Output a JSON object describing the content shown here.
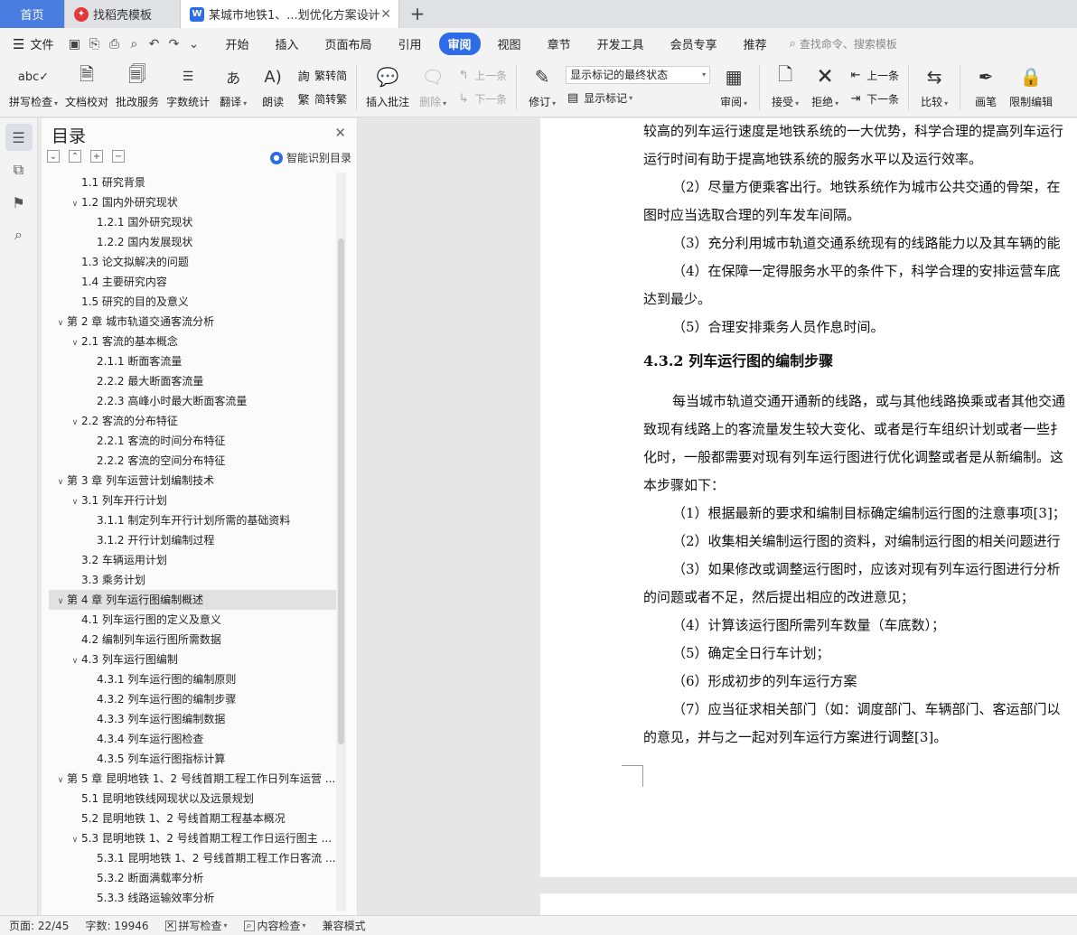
{
  "tabs": [
    {
      "label": "首页"
    },
    {
      "label": "找稻壳模板"
    },
    {
      "label": "某城市地铁1、...划优化方案设计"
    }
  ],
  "menubar": {
    "file": "文件",
    "items": [
      "开始",
      "插入",
      "页面布局",
      "引用",
      "审阅",
      "视图",
      "章节",
      "开发工具",
      "会员专享",
      "推荐"
    ],
    "active": "审阅",
    "search_placeholder": "查找命令、搜索模板"
  },
  "ribbon": {
    "spell_check": "拼写检查",
    "doc_proof": "文档校对",
    "revise_service": "批改服务",
    "word_count": "字数统计",
    "translate": "翻译",
    "read_aloud": "朗读",
    "trad": "繁转简",
    "simp": "简转繁",
    "insert_comment": "插入批注",
    "delete": "删除",
    "prev": "上一条",
    "next": "下一条",
    "track": "修订",
    "markup_state": "显示标记的最终状态",
    "show_markup": "显示标记",
    "review": "审阅",
    "accept": "接受",
    "reject": "拒绝",
    "prev2": "上一条",
    "next2": "下一条",
    "compare": "比较",
    "pen": "画笔",
    "restrict": "限制编辑"
  },
  "toc": {
    "title": "目录",
    "smart": "智能识别目录",
    "items": [
      {
        "level": 2,
        "toggle": "",
        "label": "1.1 研究背景"
      },
      {
        "level": 2,
        "toggle": "v",
        "label": "1.2 国内外研究现状"
      },
      {
        "level": 3,
        "toggle": "",
        "label": "1.2.1 国外研究现状"
      },
      {
        "level": 3,
        "toggle": "",
        "label": "1.2.2 国内发展现状"
      },
      {
        "level": 2,
        "toggle": "",
        "label": "1.3 论文拟解决的问题"
      },
      {
        "level": 2,
        "toggle": "",
        "label": "1.4 主要研究内容"
      },
      {
        "level": 2,
        "toggle": "",
        "label": "1.5 研究的目的及意义"
      },
      {
        "level": 1,
        "toggle": "v",
        "label": "第 2 章  城市轨道交通客流分析"
      },
      {
        "level": 2,
        "toggle": "v",
        "label": "2.1 客流的基本概念"
      },
      {
        "level": 3,
        "toggle": "",
        "label": "2.1.1 断面客流量"
      },
      {
        "level": 3,
        "toggle": "",
        "label": "2.2.2 最大断面客流量"
      },
      {
        "level": 3,
        "toggle": "",
        "label": "2.2.3 高峰小时最大断面客流量"
      },
      {
        "level": 2,
        "toggle": "v",
        "label": "2.2 客流的分布特征"
      },
      {
        "level": 3,
        "toggle": "",
        "label": "2.2.1 客流的时间分布特征"
      },
      {
        "level": 3,
        "toggle": "",
        "label": "2.2.2 客流的空间分布特征"
      },
      {
        "level": 1,
        "toggle": "v",
        "label": "第 3 章  列车运营计划编制技术"
      },
      {
        "level": 2,
        "toggle": "v",
        "label": "3.1 列车开行计划"
      },
      {
        "level": 3,
        "toggle": "",
        "label": "3.1.1 制定列车开行计划所需的基础资料"
      },
      {
        "level": 3,
        "toggle": "",
        "label": "3.1.2 开行计划编制过程"
      },
      {
        "level": 2,
        "toggle": "",
        "label": "3.2 车辆运用计划"
      },
      {
        "level": 2,
        "toggle": "",
        "label": "3.3 乘务计划"
      },
      {
        "level": 1,
        "toggle": "v",
        "label": "第 4 章  列车运行图编制概述",
        "selected": true
      },
      {
        "level": 2,
        "toggle": "",
        "label": "4.1 列车运行图的定义及意义"
      },
      {
        "level": 2,
        "toggle": "",
        "label": "4.2 编制列车运行图所需数据"
      },
      {
        "level": 2,
        "toggle": "v",
        "label": "4.3 列车运行图编制"
      },
      {
        "level": 3,
        "toggle": "",
        "label": "4.3.1 列车运行图的编制原则"
      },
      {
        "level": 3,
        "toggle": "",
        "label": "4.3.2 列车运行图的编制步骤"
      },
      {
        "level": 3,
        "toggle": "",
        "label": "4.3.3 列车运行图编制数据"
      },
      {
        "level": 3,
        "toggle": "",
        "label": "4.3.4 列车运行图检查"
      },
      {
        "level": 3,
        "toggle": "",
        "label": "4.3.5 列车运行图指标计算"
      },
      {
        "level": 1,
        "toggle": "v",
        "label": "第 5 章  昆明地铁 1、2 号线首期工程工作日列车运营 ..."
      },
      {
        "level": 2,
        "toggle": "",
        "label": "5.1 昆明地铁线网现状以及远景规划"
      },
      {
        "level": 2,
        "toggle": "",
        "label": "5.2 昆明地铁 1、2 号线首期工程基本概况"
      },
      {
        "level": 2,
        "toggle": "v",
        "label": "5.3 昆明地铁 1、2 号线首期工程工作日运行图主 ..."
      },
      {
        "level": 3,
        "toggle": "",
        "label": "5.3.1 昆明地铁 1、2 号线首期工程工作日客流 ..."
      },
      {
        "level": 3,
        "toggle": "",
        "label": "5.3.2 断面满载率分析"
      },
      {
        "level": 3,
        "toggle": "",
        "label": "5.3.3 线路运输效率分析"
      }
    ]
  },
  "document": {
    "lines": [
      {
        "text": "较高的列车运行速度是地铁系统的一大优势，科学合理的提高列车运行",
        "indent": 0
      },
      {
        "text": "运行时间有助于提高地铁系统的服务水平以及运行效率。",
        "indent": 0
      },
      {
        "text": "（2）尽量方便乘客出行。地铁系统作为城市公共交通的骨架，在",
        "indent": 1
      },
      {
        "text": "图时应当选取合理的列车发车间隔。",
        "indent": 0
      },
      {
        "text": "（3）充分利用城市轨道交通系统现有的线路能力以及其车辆的能",
        "indent": 1
      },
      {
        "text": "（4）在保障一定得服务水平的条件下，科学合理的安排运营车底",
        "indent": 1
      },
      {
        "text": "达到最少。",
        "indent": 0
      },
      {
        "text": "（5）合理安排乘务人员作息时间。",
        "indent": 1
      },
      {
        "text": "4.3.2 列车运行图的编制步骤",
        "indent": 0,
        "heading": true
      },
      {
        "text": "每当城市轨道交通开通新的线路，或与其他线路换乘或者其他交通",
        "indent": 1
      },
      {
        "text": "致现有线路上的客流量发生较大变化、或者是行车组织计划或者一些扌",
        "indent": 0
      },
      {
        "text": "化时，一般都需要对现有列车运行图进行优化调整或者是从新编制。这",
        "indent": 0
      },
      {
        "text": "本步骤如下：",
        "indent": 0
      },
      {
        "text": "（1）根据最新的要求和编制目标确定编制运行图的注意事项[3]；",
        "indent": 1
      },
      {
        "text": "（2）收集相关编制运行图的资料，对编制运行图的相关问题进行",
        "indent": 1
      },
      {
        "text": "（3）如果修改或调整运行图时，应该对现有列车运行图进行分析",
        "indent": 1
      },
      {
        "text": "的问题或者不足，然后提出相应的改进意见；",
        "indent": 0
      },
      {
        "text": "（4）计算该运行图所需列车数量（车底数）；",
        "indent": 1
      },
      {
        "text": "（5）确定全日行车计划；",
        "indent": 1
      },
      {
        "text": "（6）形成初步的列车运行方案",
        "indent": 1
      },
      {
        "text": "（7）应当征求相关部门（如：调度部门、车辆部门、客运部门以",
        "indent": 1
      },
      {
        "text": "的意见，并与之一起对列车运行方案进行调整[3]。",
        "indent": 0
      }
    ]
  },
  "status": {
    "page": "页面: 22/45",
    "words": "字数: 19946",
    "spell": "拼写检查",
    "content": "内容检查",
    "compat": "兼容模式"
  }
}
